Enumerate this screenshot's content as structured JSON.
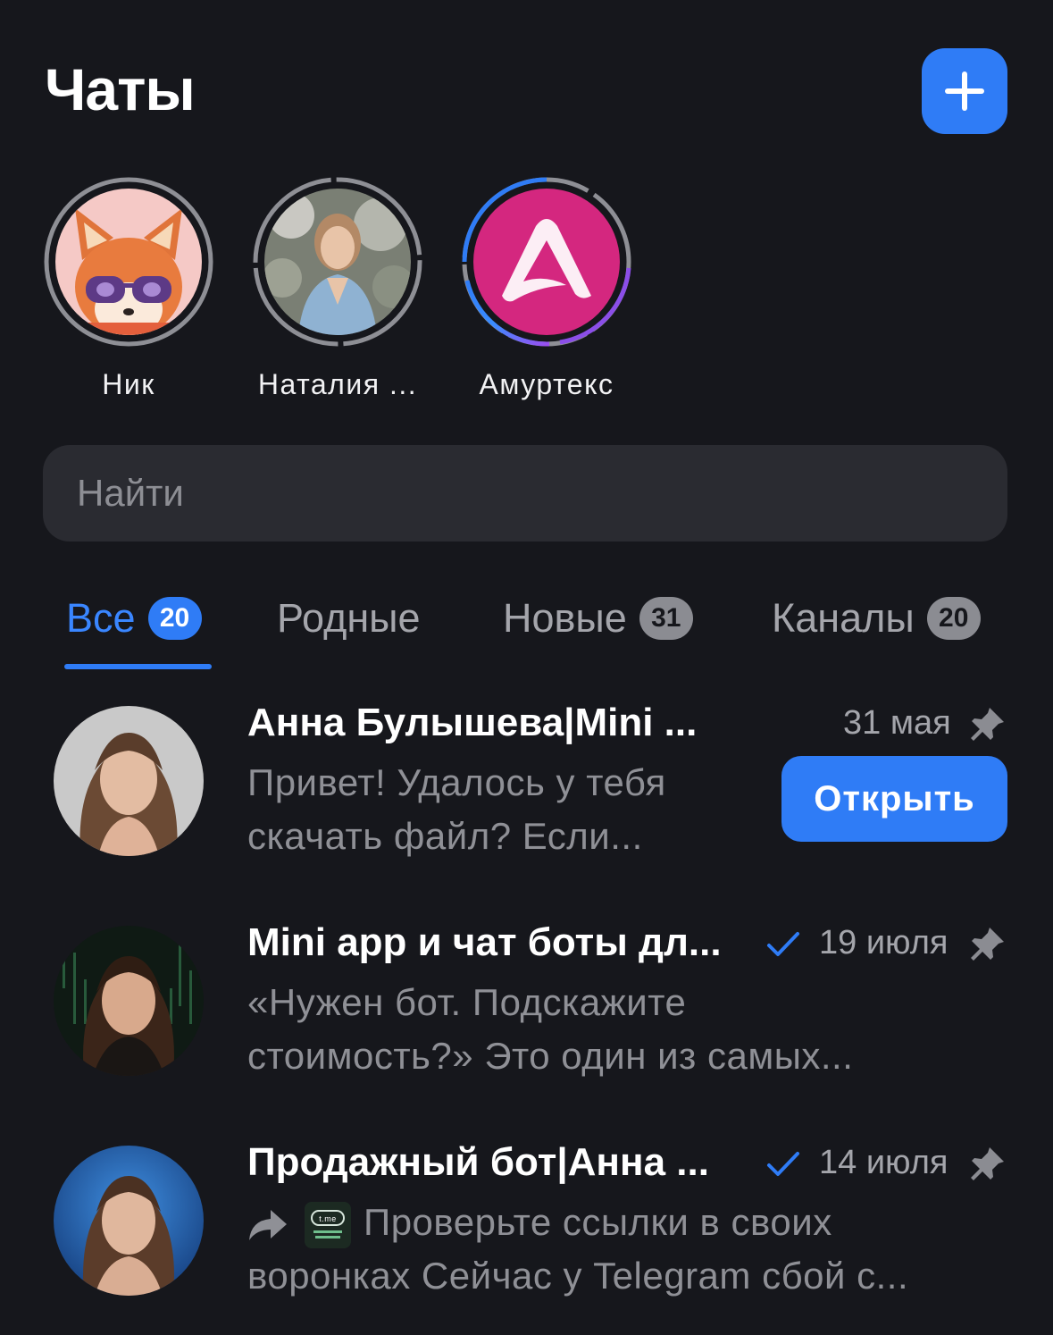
{
  "header": {
    "title": "Чаты",
    "add_icon": "plus-icon"
  },
  "stories": [
    {
      "name": "Ник",
      "ring": "gray"
    },
    {
      "name": "Наталия ...",
      "ring": "gray"
    },
    {
      "name": "Амуртекс",
      "ring": "gradient"
    }
  ],
  "search": {
    "placeholder": "Найти"
  },
  "tabs": [
    {
      "label": "Все",
      "count": "20",
      "active": true
    },
    {
      "label": "Родные",
      "count": ""
    },
    {
      "label": "Новые",
      "count": "31"
    },
    {
      "label": "Каналы",
      "count": "20"
    }
  ],
  "chats": [
    {
      "name": "Анна Булышева|Mini ...",
      "date": "31 мая",
      "pinned": true,
      "read_check": false,
      "preview_line1": "Привет! Удалось у тебя",
      "preview_line2": "скачать файл? Если...",
      "action_label": "Открыть"
    },
    {
      "name": "Mini app и чат боты дл...",
      "date": "19 июля",
      "pinned": true,
      "read_check": true,
      "preview_line1": "«Нужен бот. Подскажите",
      "preview_line2": "стоимость?» Это один из самых..."
    },
    {
      "name": "Продажный бот|Анна ...",
      "date": "14 июля",
      "pinned": true,
      "read_check": true,
      "forwarded": true,
      "thumb_text": "t.me",
      "preview_line1": "Проверьте ссылки в своих",
      "preview_line2": "воронках Сейчас у Telegram сбой с..."
    }
  ],
  "colors": {
    "accent": "#2f7cf6",
    "background": "#16171c",
    "search_bg": "#2a2b31"
  }
}
